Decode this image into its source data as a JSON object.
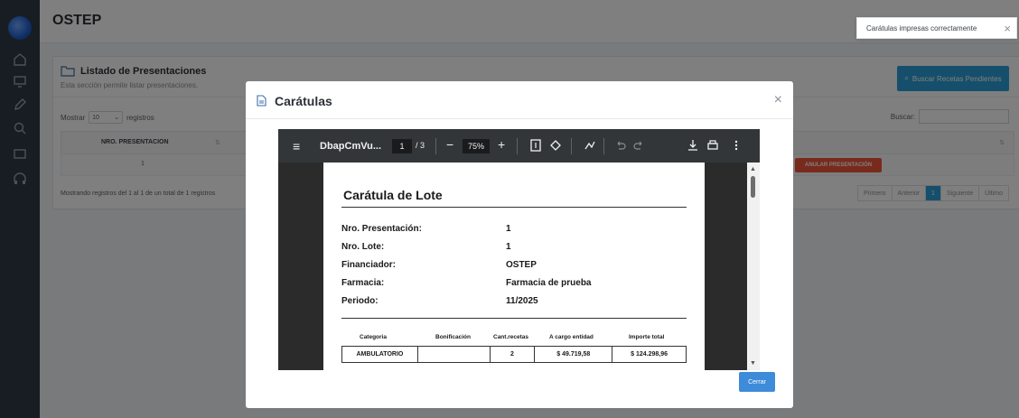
{
  "app": {
    "title": "OSTEP"
  },
  "rail": {
    "icons": [
      "home-icon",
      "monitor-icon",
      "edit-icon",
      "search-icon",
      "folder-icon",
      "headphones-icon"
    ]
  },
  "toast": {
    "message": "Carátulas impresas correctamente",
    "close": "×"
  },
  "panel": {
    "title": "Listado de Presentaciones",
    "subtitle": "Esta sección permite listar presentaciones.",
    "buscar_recetas_label": "Buscar Recetas Pendientes",
    "show_prefix": "Mostrar",
    "show_value": "10",
    "show_suffix": "registros",
    "search_label": "Buscar:",
    "columns": [
      "NRO. PRESENTACION"
    ],
    "rows": [
      {
        "nro": "1",
        "action": "ANULAR PRESENTACIÓN"
      }
    ],
    "info": "Mostrando registros del 1 al 1 de un total de 1 registros",
    "pager": {
      "first": "Primero",
      "prev": "Anterior",
      "current": "1",
      "next": "Siguiente",
      "last": "Último"
    }
  },
  "modal": {
    "title": "Carátulas",
    "close": "×",
    "cerrar_label": "Cerrar",
    "viewer": {
      "filename": "DbapCmVu...",
      "page_current": "1",
      "page_total": "/ 3",
      "zoom": "75%",
      "minus": "−",
      "plus": "+"
    },
    "doc": {
      "heading": "Carátula de Lote",
      "fields": [
        {
          "label": "Nro. Presentación:",
          "value": "1"
        },
        {
          "label": "Nro. Lote:",
          "value": "1"
        },
        {
          "label": "Financiador:",
          "value": "OSTEP"
        },
        {
          "label": "Farmacia:",
          "value": "Farmacia de prueba"
        },
        {
          "label": "Periodo:",
          "value": "11/2025"
        }
      ],
      "table_headers": [
        "Categoria",
        "Bonificación",
        "Cant.recetas",
        "A cargo entidad",
        "Importe total"
      ],
      "table_rows": [
        [
          "AMBULATORIO",
          "",
          "2",
          "$ 49.719,58",
          "$ 124.298,96"
        ]
      ]
    }
  }
}
